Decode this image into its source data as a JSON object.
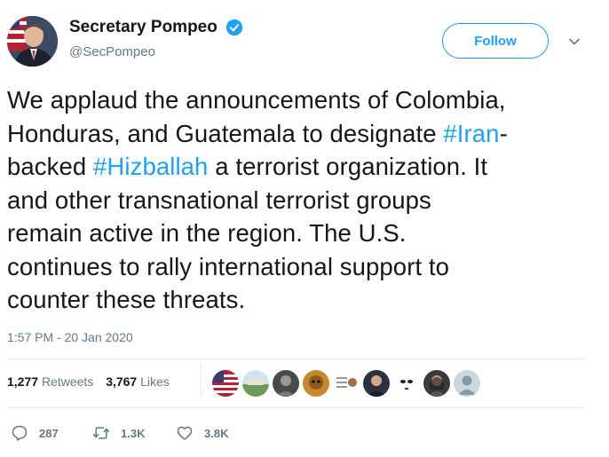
{
  "user": {
    "display_name": "Secretary Pompeo",
    "handle": "@SecPompeo",
    "verified_icon": "verified-badge-icon"
  },
  "follow_label": "Follow",
  "tweet": {
    "lines": [
      [
        {
          "t": "We applaud the announcements of Colombia,"
        }
      ],
      [
        {
          "t": "Honduras, and Guatemala to designate "
        },
        {
          "t": "#Iran",
          "link": true
        },
        {
          "t": "-"
        }
      ],
      [
        {
          "t": "backed "
        },
        {
          "t": "#Hizballah",
          "link": true
        },
        {
          "t": " a terrorist organization. It"
        }
      ],
      [
        {
          "t": "and other transnational terrorist groups"
        }
      ],
      [
        {
          "t": "remain active in the region. The U.S."
        }
      ],
      [
        {
          "t": "continues to rally international support to"
        }
      ],
      [
        {
          "t": "counter these threats."
        }
      ]
    ]
  },
  "timestamp": "1:57 PM - 20 Jan 2020",
  "stats": {
    "retweets_count": "1,277",
    "retweets_label": "Retweets",
    "likes_count": "3,767",
    "likes_label": "Likes"
  },
  "actions": {
    "reply_count": "287",
    "retweet_count": "1.3K",
    "like_count": "3.8K"
  },
  "colors": {
    "link": "#1da1f2",
    "muted": "#657786",
    "text": "#14171a",
    "divider": "#e6ecf0"
  }
}
